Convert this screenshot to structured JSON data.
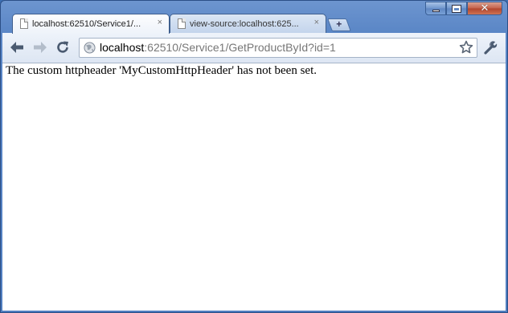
{
  "tabs": [
    {
      "title": "localhost:62510/Service1/...",
      "close": "×",
      "active": true
    },
    {
      "title": "view-source:localhost:625...",
      "close": "×",
      "active": false
    }
  ],
  "new_tab_label": "+",
  "window_controls": {
    "minimize": "minimize-icon",
    "maximize": "maximize-icon",
    "close": "close-icon"
  },
  "toolbar": {
    "back_icon": "back-arrow-icon",
    "forward_icon": "forward-arrow-icon",
    "reload_icon": "reload-icon",
    "wrench_icon": "wrench-icon"
  },
  "omnibox": {
    "host": "localhost",
    "rest": ":62510/Service1/GetProductById?id=1",
    "icon": "globe-icon",
    "bookmark_icon": "star-icon"
  },
  "page": {
    "message": "The custom httpheader 'MyCustomHttpHeader' has not been set."
  },
  "colors": {
    "frame": "#5a86c6",
    "toolbar": "#e6edf7",
    "content": "#ffffff"
  }
}
